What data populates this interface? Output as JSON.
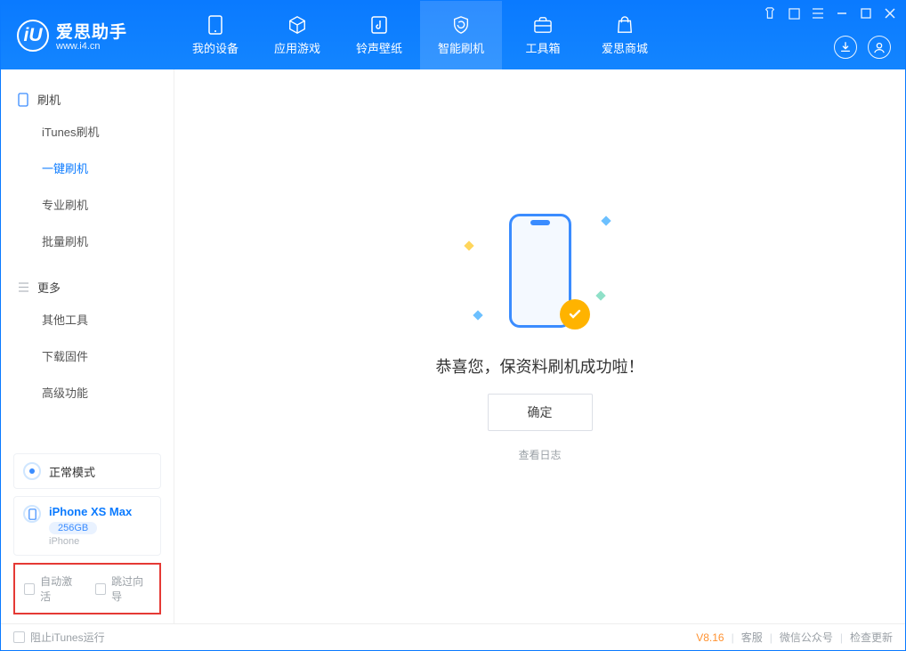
{
  "app": {
    "name": "爱思助手",
    "domain": "www.i4.cn"
  },
  "nav": {
    "my_device": "我的设备",
    "apps_games": "应用游戏",
    "ringwall": "铃声壁纸",
    "smart_flash": "智能刷机",
    "toolbox": "工具箱",
    "store": "爱思商城"
  },
  "sidebar": {
    "group1": {
      "title": "刷机",
      "items": [
        "iTunes刷机",
        "一键刷机",
        "专业刷机",
        "批量刷机"
      ]
    },
    "group2": {
      "title": "更多",
      "items": [
        "其他工具",
        "下载固件",
        "高级功能"
      ]
    }
  },
  "mode_card": {
    "label": "正常模式"
  },
  "device_card": {
    "name": "iPhone XS Max",
    "capacity": "256GB",
    "type": "iPhone"
  },
  "options": {
    "auto_activate": "自动激活",
    "skip_guide": "跳过向导"
  },
  "main": {
    "success_msg": "恭喜您，保资料刷机成功啦！",
    "ok": "确定",
    "view_log": "查看日志"
  },
  "footer": {
    "block_itunes": "阻止iTunes运行",
    "version": "V8.16",
    "support": "客服",
    "wechat": "微信公众号",
    "update": "检查更新"
  }
}
